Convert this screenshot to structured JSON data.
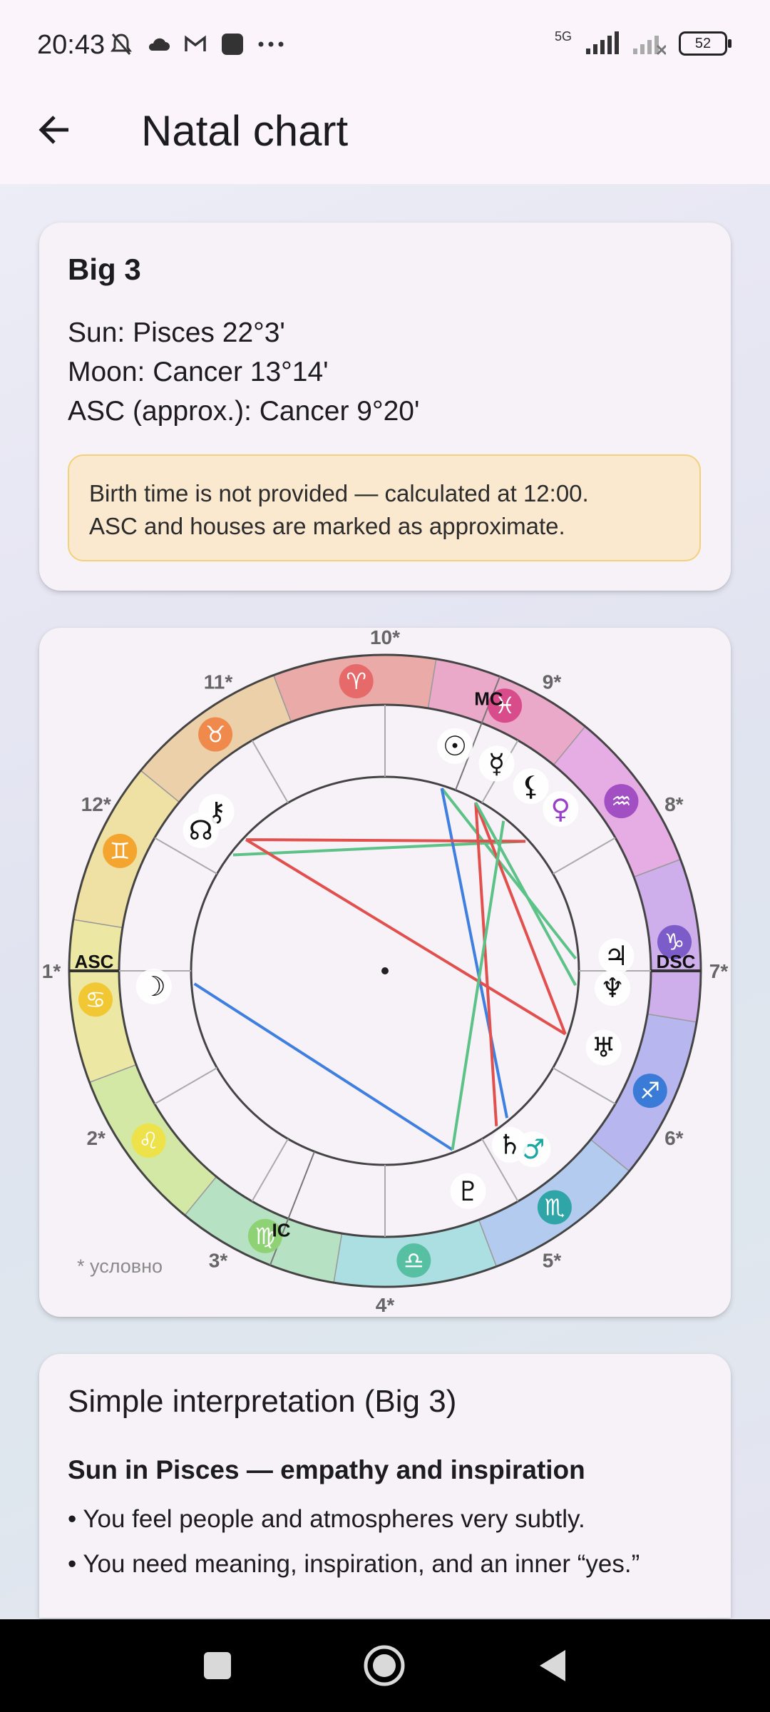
{
  "status_bar": {
    "time": "20:43",
    "network": "5G",
    "battery": "52",
    "icons": [
      "mute-bell-icon",
      "cloud-icon",
      "gmail-icon",
      "app-icon",
      "more-dots-icon",
      "signal-icon",
      "signal-weak-icon",
      "battery-icon"
    ]
  },
  "app_bar": {
    "title": "Natal chart",
    "back_icon": "arrow-back-icon"
  },
  "big3": {
    "title": "Big 3",
    "sun": "Sun: Pisces 22°3'",
    "moon": "Moon: Cancer 13°14'",
    "asc": "ASC (approx.): Cancer 9°20'",
    "notice_line1": "Birth time is not provided — calculated at 12:00.",
    "notice_line2": "ASC and houses are marked as approximate."
  },
  "wheel": {
    "footnote": "* условно",
    "house_labels": [
      "1*",
      "2*",
      "3*",
      "4*",
      "5*",
      "6*",
      "7*",
      "8*",
      "9*",
      "10*",
      "11*",
      "12*"
    ],
    "axis_labels": {
      "asc": "ASC",
      "dsc": "DSC",
      "mc": "MC",
      "ic": "IC"
    },
    "sign_glyphs": [
      "♈",
      "♉",
      "♊",
      "♋",
      "♌",
      "♍",
      "♎",
      "♏",
      "♐",
      "♑",
      "♒",
      "♓"
    ],
    "sign_colors": [
      "#e76a6a",
      "#ef8a4c",
      "#f3a530",
      "#f2c734",
      "#ede24a",
      "#8fd276",
      "#58c0a2",
      "#30a5a7",
      "#3a7bd8",
      "#7c5cc8",
      "#a14fc2",
      "#d94c8c"
    ],
    "planets": [
      {
        "name": "sun",
        "glyph": "☉"
      },
      {
        "name": "mercury",
        "glyph": "☿"
      },
      {
        "name": "lilith",
        "glyph": "⚸"
      },
      {
        "name": "venus",
        "glyph": "♀"
      },
      {
        "name": "jupiter",
        "glyph": "♃"
      },
      {
        "name": "neptune",
        "glyph": "♆"
      },
      {
        "name": "uranus",
        "glyph": "♅"
      },
      {
        "name": "mars",
        "glyph": "♂"
      },
      {
        "name": "saturn",
        "glyph": "♄"
      },
      {
        "name": "pluto",
        "glyph": "♇"
      },
      {
        "name": "moon",
        "glyph": "☽"
      },
      {
        "name": "chiron",
        "glyph": "⚷"
      },
      {
        "name": "node",
        "glyph": "☊"
      }
    ],
    "aspect_colors": {
      "harmonious": "#5cc288",
      "tense": "#e2504e",
      "opposition": "#3f7fe0"
    }
  },
  "interpretation": {
    "title": "Simple interpretation (Big 3)",
    "sun_heading": "Sun in Pisces — empathy and inspiration",
    "bullets": [
      "• You feel people and atmospheres very subtly.",
      "• You need meaning, inspiration, and an inner “yes.”"
    ]
  }
}
